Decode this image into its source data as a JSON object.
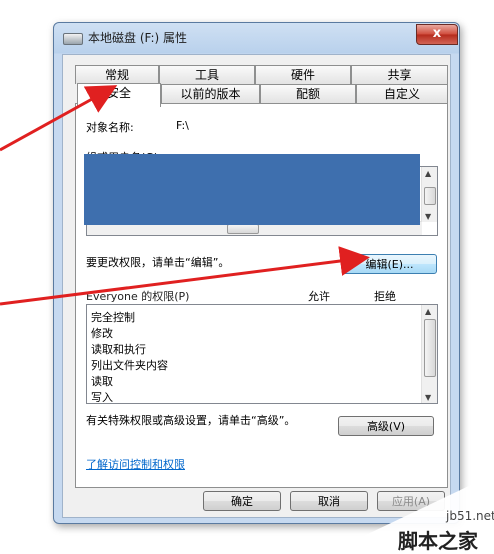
{
  "window": {
    "title": "本地磁盘 (F:) 属性",
    "close_label": "x"
  },
  "tabs_row1": [
    {
      "label": "常规"
    },
    {
      "label": "工具"
    },
    {
      "label": "硬件"
    },
    {
      "label": "共享"
    }
  ],
  "tabs_row2": [
    {
      "label": "安全",
      "active": true
    },
    {
      "label": "以前的版本"
    },
    {
      "label": "配额"
    },
    {
      "label": "自定义"
    }
  ],
  "security": {
    "object_name_label": "对象名称:",
    "object_name_value": "F:\\",
    "groups_label": "组或用户名(G):",
    "change_hint": "要更改权限，请单击“编辑”。",
    "edit_button": "编辑(E)...",
    "perms_label": "Everyone 的权限(P)",
    "allow_header": "允许",
    "deny_header": "拒绝",
    "permissions": [
      "完全控制",
      "修改",
      "读取和执行",
      "列出文件夹内容",
      "读取",
      "写入"
    ],
    "special_hint": "有关特殊权限或高级设置，请单击“高级”。",
    "advanced_button": "高级(V)",
    "learn_link": "了解访问控制和权限"
  },
  "footer": {
    "ok_button": "确定",
    "cancel_button": "取消",
    "apply_button": "应用(A)"
  },
  "watermark": {
    "site": "jb51.net",
    "name": "脚本之家"
  },
  "colors": {
    "annotation_arrow": "#e02020",
    "redaction": "#3e6fae",
    "title_bar": "#cfe0f3"
  }
}
